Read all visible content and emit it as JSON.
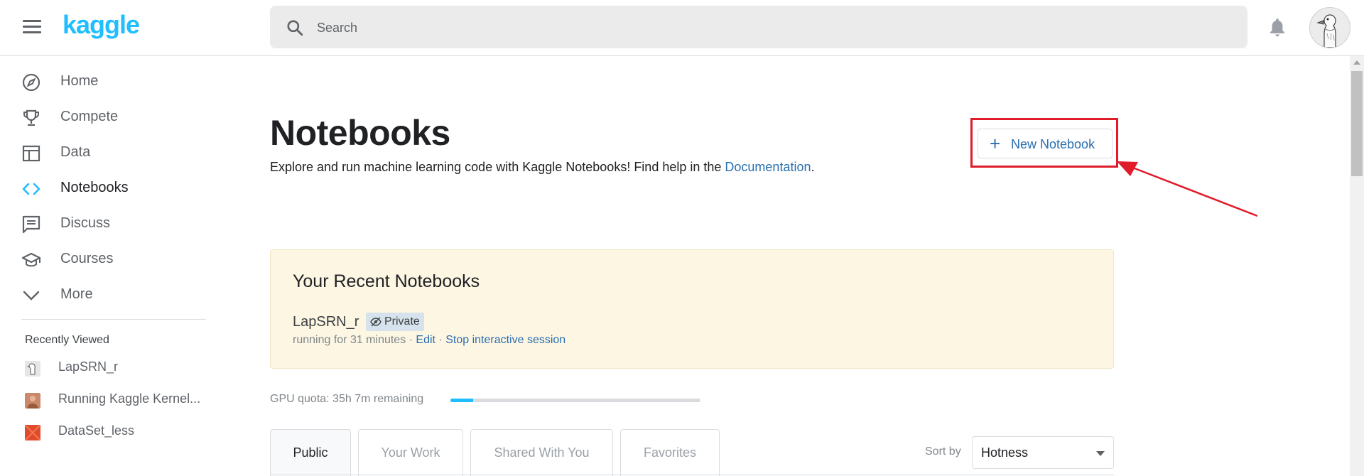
{
  "header": {
    "logo": "kaggle",
    "search_placeholder": "Search"
  },
  "sidebar": {
    "items": [
      {
        "label": "Home",
        "icon": "compass-icon"
      },
      {
        "label": "Compete",
        "icon": "trophy-icon"
      },
      {
        "label": "Data",
        "icon": "table-icon"
      },
      {
        "label": "Notebooks",
        "icon": "code-icon",
        "active": true
      },
      {
        "label": "Discuss",
        "icon": "comment-icon"
      },
      {
        "label": "Courses",
        "icon": "school-icon"
      },
      {
        "label": "More",
        "icon": "chevron-down-icon"
      }
    ],
    "recently_viewed_title": "Recently Viewed",
    "recently_viewed": [
      {
        "label": "LapSRN_r"
      },
      {
        "label": "Running Kaggle Kernel..."
      },
      {
        "label": "DataSet_less"
      }
    ]
  },
  "main": {
    "title": "Notebooks",
    "subtitle_text": "Explore and run machine learning code with Kaggle Notebooks! Find help in the ",
    "subtitle_link": "Documentation",
    "subtitle_end": ".",
    "new_notebook_label": "New Notebook",
    "recent": {
      "title": "Your Recent Notebooks",
      "notebook_name": "LapSRN_r",
      "badge": "Private",
      "status": "running for 31 minutes",
      "sep": " · ",
      "edit_link": "Edit",
      "stop_link": "Stop interactive session"
    },
    "gpu_quota": {
      "label": "GPU quota: 35h 7m remaining",
      "used_fraction": 0.09
    },
    "tabs": [
      {
        "label": "Public",
        "active": true
      },
      {
        "label": "Your Work"
      },
      {
        "label": "Shared With You"
      },
      {
        "label": "Favorites"
      }
    ],
    "sort": {
      "label": "Sort by",
      "value": "Hotness"
    }
  },
  "colors": {
    "brand": "#20beff",
    "link": "#2a6fb0",
    "highlight_box": "#e01b2a",
    "recent_bg": "#fcf6e3"
  }
}
